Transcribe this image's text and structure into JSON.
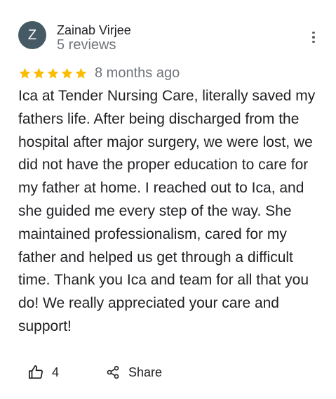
{
  "review": {
    "author": {
      "initial": "Z",
      "name": "Zainab Virjee",
      "meta": "5 reviews",
      "avatar_color": "#455a64"
    },
    "menu_icon": "more-vert-icon",
    "rating": {
      "stars": 5,
      "max_stars": 5,
      "star_color": "#fbbc04",
      "star_icon": "star-icon"
    },
    "date": "8 months ago",
    "text": "Ica at Tender Nursing Care, literally saved my fathers life. After being discharged from the hospital after major surgery, we were lost, we did not have the proper education to care for my father at home. I reached out to Ica, and she guided me every step of the way. She maintained professionalism, cared for my father and helped us get through a difficult time. Thank you Ica and team for all that you do! We really appreciated your care and support!",
    "actions": {
      "like_icon": "thumbs-up-icon",
      "like_count": "4",
      "share_icon": "share-icon",
      "share_label": "Share"
    }
  }
}
